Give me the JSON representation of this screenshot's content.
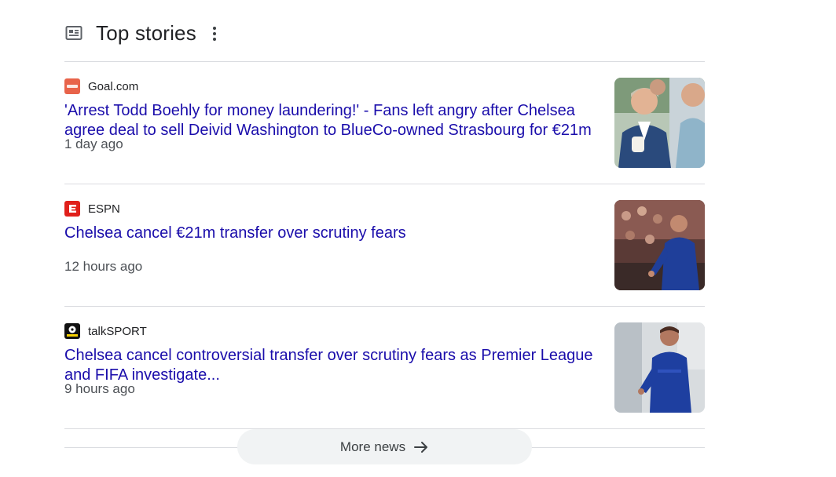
{
  "header": {
    "title": "Top stories",
    "icon": "newspaper-icon",
    "menu_icon": "more-vert-icon"
  },
  "stories": [
    {
      "source": "Goal.com",
      "headline": "'Arrest Todd Boehly for money laundering!' - Fans left angry after Chelsea agree deal to sell Deivid Washington to BlueCo-owned Strasbourg for €21m",
      "time": "1 day ago",
      "logo_color": "#e8634a"
    },
    {
      "source": "ESPN",
      "headline": "Chelsea cancel €21m transfer over scrutiny fears",
      "time": "12 hours ago",
      "logo_color": "#e0201b"
    },
    {
      "source": "talkSPORT",
      "headline": "Chelsea cancel controversial transfer over scrutiny fears as Premier League and FIFA investigate...",
      "time": "9 hours ago",
      "logo_color": "#111111"
    }
  ],
  "more": {
    "label": "More news"
  },
  "colors": {
    "link": "#1a0dab",
    "divider": "#dadce0",
    "button_bg": "#f1f3f4"
  }
}
